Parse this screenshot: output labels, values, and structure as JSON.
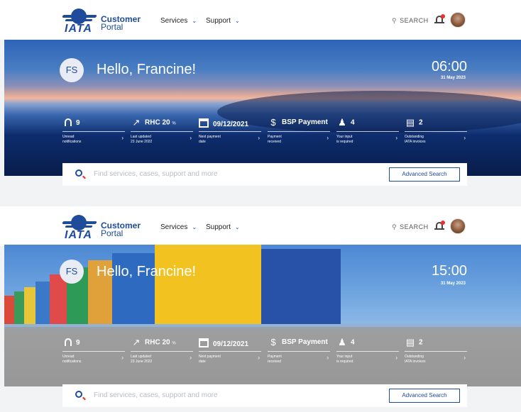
{
  "panels": [
    {
      "header": {
        "logo_text": "IATA",
        "portal_name_line1": "Customer",
        "portal_name_line2": "Portal",
        "nav": [
          "Services",
          "Support"
        ],
        "search_label": "SEARCH"
      },
      "hero": {
        "initials": "FS",
        "greeting": "Hello, Francine!",
        "time": "06:00",
        "date": "31 May 2023"
      },
      "stats": [
        {
          "icon": "bell-icon",
          "value": "9",
          "desc_line1": "Unread",
          "desc_line2": "notifications"
        },
        {
          "icon": "trend-chart-icon",
          "value": "RHC 20",
          "unit": "%",
          "desc_line1": "Last updated",
          "desc_line2": "23 June 2022"
        },
        {
          "icon": "calendar-icon",
          "value": "09/12/2021",
          "desc_line1": "Next payment",
          "desc_line2": "date"
        },
        {
          "icon": "dollar-icon",
          "value": "BSP Payment",
          "desc_line1": "Payment",
          "desc_line2": "received"
        },
        {
          "icon": "users-icon",
          "value": "4",
          "desc_line1": "Your input",
          "desc_line2": "is required"
        },
        {
          "icon": "invoice-icon",
          "value": "2",
          "desc_line1": "Outstanding",
          "desc_line2": "IATA invoices"
        }
      ],
      "search": {
        "placeholder": "Find services, cases, support and more",
        "advanced_label": "Advanced Search"
      }
    },
    {
      "header": {
        "logo_text": "IATA",
        "portal_name_line1": "Customer",
        "portal_name_line2": "Portal",
        "nav": [
          "Services",
          "Support"
        ],
        "search_label": "SEARCH"
      },
      "hero": {
        "initials": "FS",
        "greeting": "Hello, Francine!",
        "time": "15:00",
        "date": "31 May 2023"
      },
      "stats": [
        {
          "icon": "bell-icon",
          "value": "9",
          "desc_line1": "Unread",
          "desc_line2": "notifications"
        },
        {
          "icon": "trend-chart-icon",
          "value": "RHC 20",
          "unit": "%",
          "desc_line1": "Last updated",
          "desc_line2": "23 June 2022"
        },
        {
          "icon": "calendar-icon",
          "value": "09/12/2021",
          "desc_line1": "Next payment",
          "desc_line2": "date"
        },
        {
          "icon": "dollar-icon",
          "value": "BSP Payment",
          "desc_line1": "Payment",
          "desc_line2": "received"
        },
        {
          "icon": "users-icon",
          "value": "4",
          "desc_line1": "Your input",
          "desc_line2": "is required"
        },
        {
          "icon": "invoice-icon",
          "value": "2",
          "desc_line1": "Outstanding",
          "desc_line2": "IATA invoices"
        }
      ],
      "search": {
        "placeholder": "Find services, cases, support and more",
        "advanced_label": "Advanced Search"
      }
    }
  ],
  "colors": {
    "brand_blue": "#1e4c9a",
    "alert_red": "#e8322f",
    "header_bg": "#ffffff"
  }
}
